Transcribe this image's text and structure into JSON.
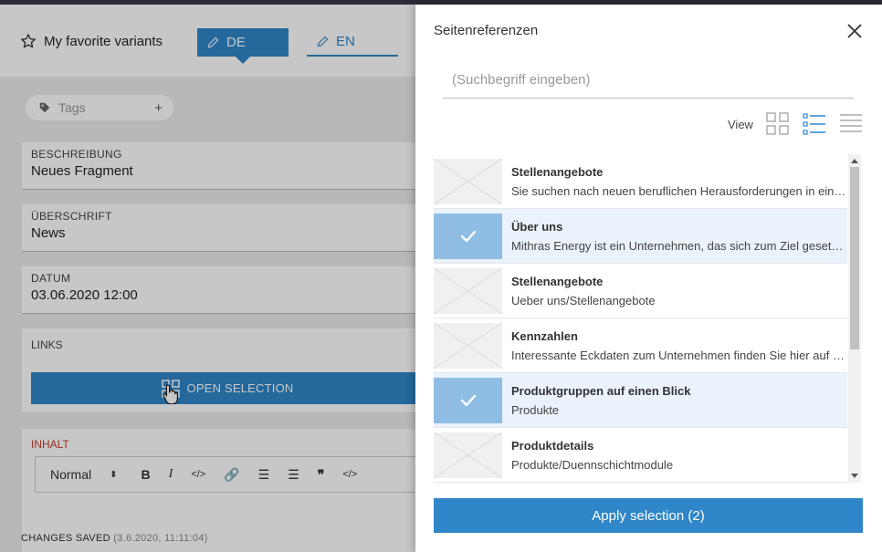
{
  "editor": {
    "favorites_label": "My favorite variants",
    "lang_de": "DE",
    "lang_en": "EN",
    "tags_label": "Tags",
    "tags_add": "+",
    "fields": [
      {
        "label": "BESCHREIBUNG",
        "value": "Neues Fragment"
      },
      {
        "label": "ÜBERSCHRIFT",
        "value": "News"
      },
      {
        "label": "DATUM",
        "value": "03.06.2020 12:00"
      }
    ],
    "links_label": "LINKS",
    "open_selection": "OPEN SELECTION",
    "content_label": "INHALT",
    "toolbar": {
      "format": "Normal"
    },
    "status": {
      "label": "CHANGES SAVED",
      "time": "(3.6.2020, 11:11:04)"
    }
  },
  "panel": {
    "title": "Seitenreferenzen",
    "search_placeholder": "(Suchbegriff eingeben)",
    "view_label": "View",
    "items": [
      {
        "title": "Stellenangebote",
        "desc": "Sie suchen nach neuen beruflichen Herausforderungen in einem...",
        "selected": false
      },
      {
        "title": "Über uns",
        "desc": "Mithras Energy ist ein Unternehmen, das sich zum Ziel gesetzt...",
        "selected": true
      },
      {
        "title": "Stellenangebote",
        "desc": "Ueber uns/Stellenangebote",
        "selected": false
      },
      {
        "title": "Kennzahlen",
        "desc": "Interessante Eckdaten zum Unternehmen finden Sie hier auf einen...",
        "selected": false
      },
      {
        "title": "Produktgruppen auf einen Blick",
        "desc": "Produkte",
        "selected": true
      },
      {
        "title": "Produktdetails",
        "desc": "Produkte/Duennschichtmodule",
        "selected": false
      }
    ],
    "apply_label": "Apply selection (2)"
  },
  "colors": {
    "accent": "#2f86c8",
    "selected_thumb": "#8fbde3"
  }
}
